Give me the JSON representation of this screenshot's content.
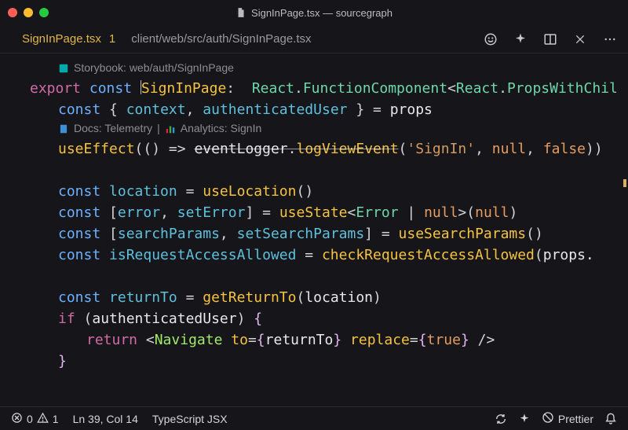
{
  "window": {
    "title": "SignInPage.tsx — sourcegraph"
  },
  "tab": {
    "name": "SignInPage.tsx",
    "modified_badge": "1",
    "breadcrumb": "client/web/src/auth/SignInPage.tsx"
  },
  "codelens": {
    "storybook": "Storybook: web/auth/SignInPage",
    "docs": "Docs: Telemetry",
    "separator": " | ",
    "analytics": "Analytics: SignIn"
  },
  "code": {
    "export": "export",
    "const": "const",
    "ident_SignInPage": "SignInPage",
    "colon": ":",
    "react_fc": "React",
    "dot": ".",
    "FunctionComponent": "FunctionComponent",
    "lt": "<",
    "gt": ">",
    "PropsWithChil": "PropsWithChil",
    "lbrace": "{",
    "rbrace": "}",
    "context": "context",
    "comma": ",",
    "authenticatedUser": "authenticatedUser",
    "eq": " = ",
    "props": "props",
    "useEffect": "useEffect",
    "lparen": "(",
    "rparen": ")",
    "arrow": " => ",
    "eventLogger": "eventLogger",
    "logViewEvent": "logViewEvent",
    "str_SignIn": "'SignIn'",
    "null": "null",
    "false": "false",
    "location": "location",
    "useLocation": "useLocation",
    "lbracket": "[",
    "rbracket": "]",
    "error": "error",
    "setError": "setError",
    "useState": "useState",
    "Error": "Error",
    "pipe": " | ",
    "searchParams": "searchParams",
    "setSearchParams": "setSearchParams",
    "useSearchParams": "useSearchParams",
    "isRequestAccessAllowed": "isRequestAccessAllowed",
    "checkRequestAccessAllowed": "checkRequestAccessAllowed",
    "props_dot": "props.",
    "returnTo": "returnTo",
    "getReturnTo": "getReturnTo",
    "if": "if",
    "return": "return",
    "Navigate": "Navigate",
    "to_attr": "to",
    "replace_attr": "replace",
    "true": "true",
    "slash_gt": " />"
  },
  "status": {
    "errors": "0",
    "warnings": "1",
    "cursor": "Ln 39, Col 14",
    "language": "TypeScript JSX",
    "prettier": "Prettier"
  }
}
